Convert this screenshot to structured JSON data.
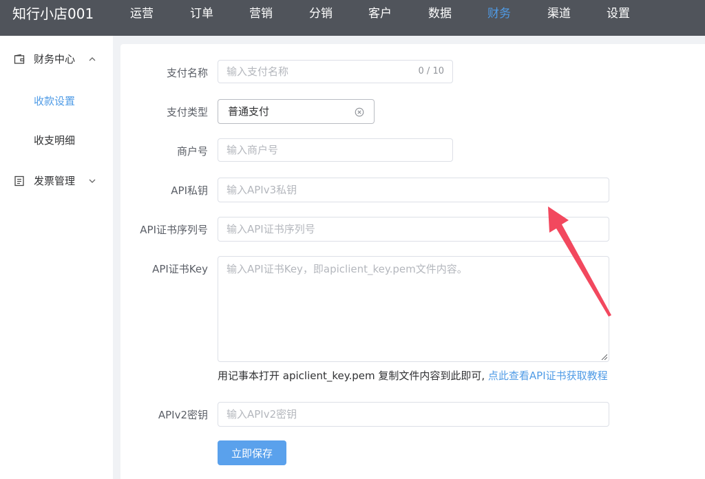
{
  "app": {
    "brand": "知行小店001"
  },
  "nav": {
    "items": [
      "运营",
      "订单",
      "营销",
      "分销",
      "客户",
      "数据",
      "财务",
      "渠道",
      "设置"
    ],
    "active": "财务"
  },
  "sidebar": {
    "groups": [
      {
        "label": "财务中心",
        "icon": "wallet-icon",
        "expanded": true,
        "children": [
          "收款设置",
          "收支明细"
        ]
      },
      {
        "label": "发票管理",
        "icon": "invoice-icon",
        "expanded": false
      }
    ],
    "active_child": "收款设置"
  },
  "form": {
    "pay_name": {
      "label": "支付名称",
      "placeholder": "输入支付名称",
      "counter": "0 / 10"
    },
    "pay_type": {
      "label": "支付类型",
      "value": "普通支付"
    },
    "merchant_id": {
      "label": "商户号",
      "placeholder": "输入商户号"
    },
    "api_private_key": {
      "label": "API私钥",
      "placeholder": "输入APIv3私钥"
    },
    "api_cert_serial": {
      "label": "API证书序列号",
      "placeholder": "输入API证书序列号"
    },
    "api_cert_key": {
      "label": "API证书Key",
      "placeholder": "输入API证书Key，即apiclient_key.pem文件内容。"
    },
    "help": {
      "text": "用记事本打开 apiclient_key.pem 复制文件内容到此即可, ",
      "link": "点此查看API证书获取教程"
    },
    "apiv2_key": {
      "label": "APIv2密钥",
      "placeholder": "输入APIv2密钥"
    },
    "save_label": "立即保存"
  },
  "colors": {
    "topbar": "#50545b",
    "accent": "#4f9be6",
    "button": "#5aa1ec",
    "annotation_arrow": "#f2485e"
  }
}
